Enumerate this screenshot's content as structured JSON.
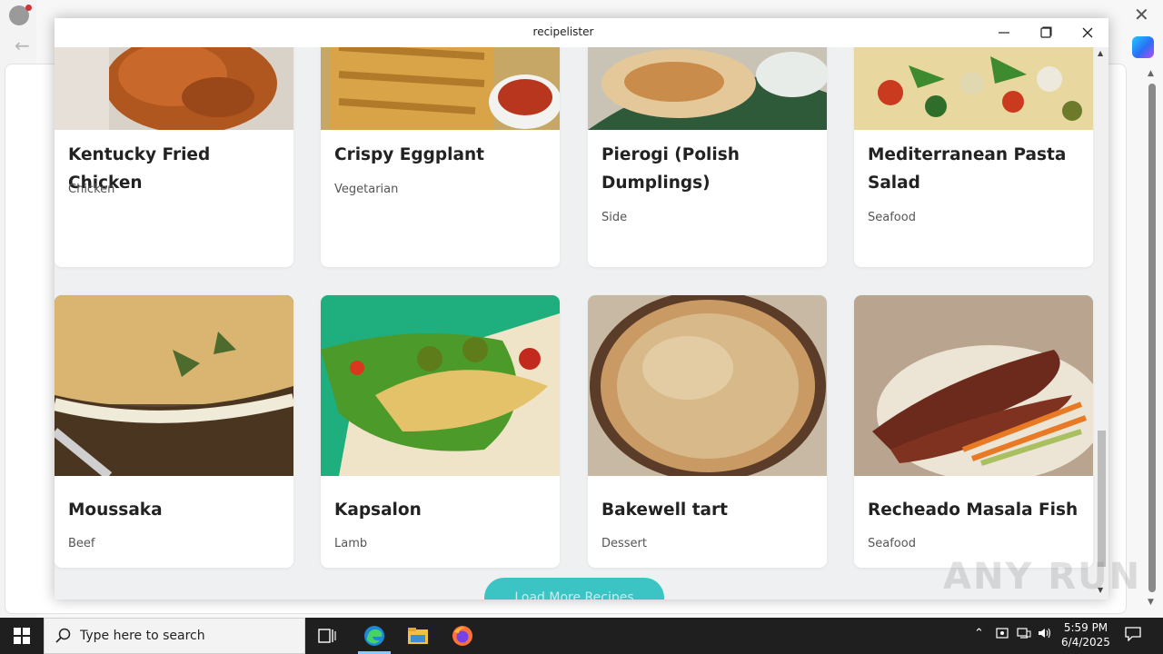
{
  "window": {
    "title": "recipelister"
  },
  "recipes_row1": [
    {
      "name": "Kentucky Fried Chicken",
      "category": "Chicken"
    },
    {
      "name": "Crispy Eggplant",
      "category": "Vegetarian"
    },
    {
      "name": "Pierogi (Polish Dumplings)",
      "category": "Side"
    },
    {
      "name": "Mediterranean Pasta Salad",
      "category": "Seafood"
    }
  ],
  "recipes_row2": [
    {
      "name": "Moussaka",
      "category": "Beef"
    },
    {
      "name": "Kapsalon",
      "category": "Lamb"
    },
    {
      "name": "Bakewell tart",
      "category": "Dessert"
    },
    {
      "name": "Recheado Masala Fish",
      "category": "Seafood"
    }
  ],
  "load_more": {
    "label": "Load More Recipes"
  },
  "watermark": "ANY RUN",
  "taskbar": {
    "search_placeholder": "Type here to search",
    "time": "5:59 PM",
    "date": "6/4/2025"
  },
  "colors": {
    "accent": "#3cc4c5",
    "taskbar": "#1f1f1f"
  }
}
